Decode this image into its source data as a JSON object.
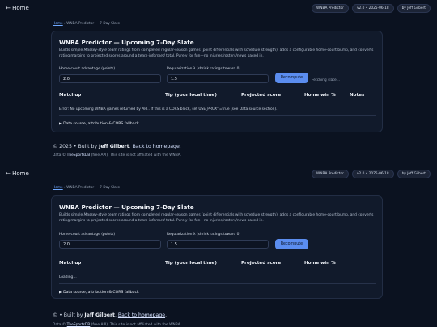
{
  "nav": {
    "back_label": "← Home",
    "badges": [
      "WNBA Predictor",
      "v2.0 • 2025-06-18",
      "by Jeff Gilbert"
    ]
  },
  "breadcrumb": {
    "link": "Home",
    "current": "WNBA Predictor — 7-Day Slate"
  },
  "card": {
    "title": "WNBA Predictor — Upcoming 7-Day Slate",
    "desc_a": "Builds simple ",
    "desc_em": "Massey-style",
    "desc_b": " team ratings from completed regular-season games (point differentials with schedule strength), adds a configurable home-court bump, and converts rating margins to projected scores around a ",
    "desc_em2": "team-informed",
    "desc_c": " total. Purely for fun—no injuries/rosters/news baked in.",
    "hca_label": "Home-court advantage (points)",
    "hca_value": "2.0",
    "reg_label": "Regularization λ (shrink ratings toward 0)",
    "reg_value": "1.5",
    "recompute_label": "Recompute",
    "columns": [
      "Matchup",
      "Tip (your local time)",
      "Projected score",
      "Home win %",
      "Notes"
    ],
    "details_label": "Data source, attribution & CORS fallback"
  },
  "state_a": {
    "status": "Fetching slate…",
    "message": "Error: No upcoming WNBA games returned by API.. If this is a CORS block, set USE_PROXY=true (see Data source section)."
  },
  "state_b": {
    "message": "Loading…"
  },
  "footer_a": {
    "copy": "© 2025 • Built by ",
    "author": "Jeff Gilbert",
    "sep": ". ",
    "back_link": "Back to homepage",
    "end": "."
  },
  "footer_b": {
    "copy": "© • Built by ",
    "author": "Jeff Gilbert",
    "sep": ". ",
    "back_link": "Back to homepage",
    "end": "."
  },
  "attribution": {
    "prefix": "Data © ",
    "source": "TheSportsDB",
    "suffix": " (free API). This site is not affiliated with the WNBA."
  }
}
